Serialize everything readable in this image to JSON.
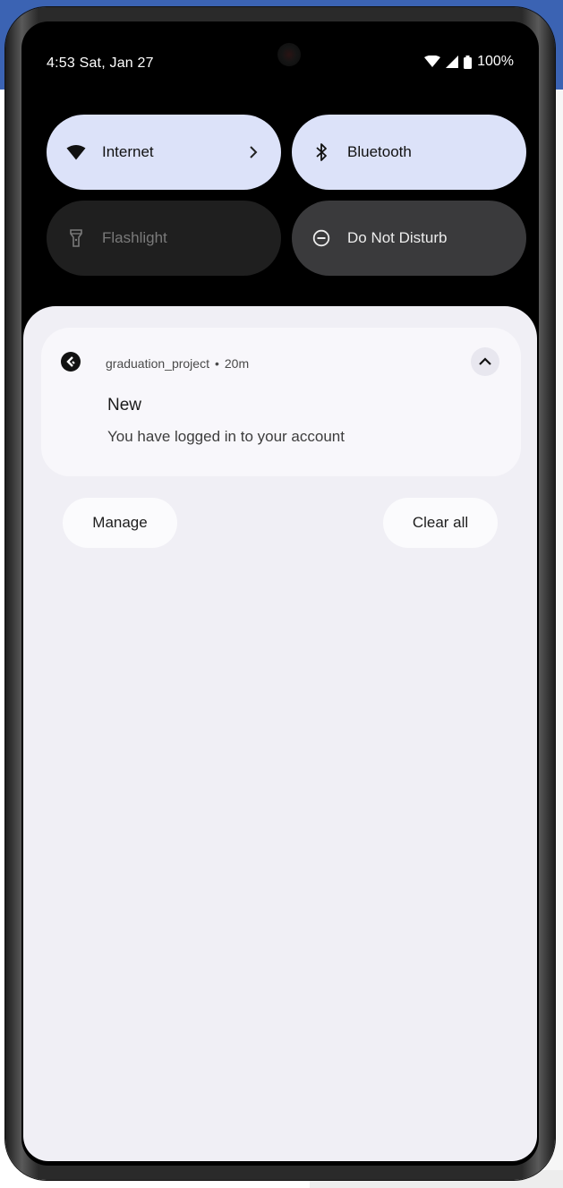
{
  "status_bar": {
    "time_date": "4:53 Sat, Jan 27",
    "battery": "100%"
  },
  "quick_settings": {
    "tiles": [
      {
        "label": "Internet",
        "icon": "wifi-icon",
        "state": "on"
      },
      {
        "label": "Bluetooth",
        "icon": "bluetooth-icon",
        "state": "on"
      },
      {
        "label": "Flashlight",
        "icon": "flashlight-icon",
        "state": "unavailable"
      },
      {
        "label": "Do Not Disturb",
        "icon": "do-not-disturb-icon",
        "state": "off"
      }
    ]
  },
  "notification": {
    "app_name": "graduation_project",
    "separator": "•",
    "time": "20m",
    "title": "New",
    "body": "You have logged in to your account"
  },
  "actions": {
    "manage": "Manage",
    "clear_all": "Clear all"
  },
  "colors": {
    "tile_active": "#dce2f9",
    "tile_inactive": "#3a3a3c",
    "shade_background": "#f0eff5",
    "background_band": "#3b63b3"
  }
}
